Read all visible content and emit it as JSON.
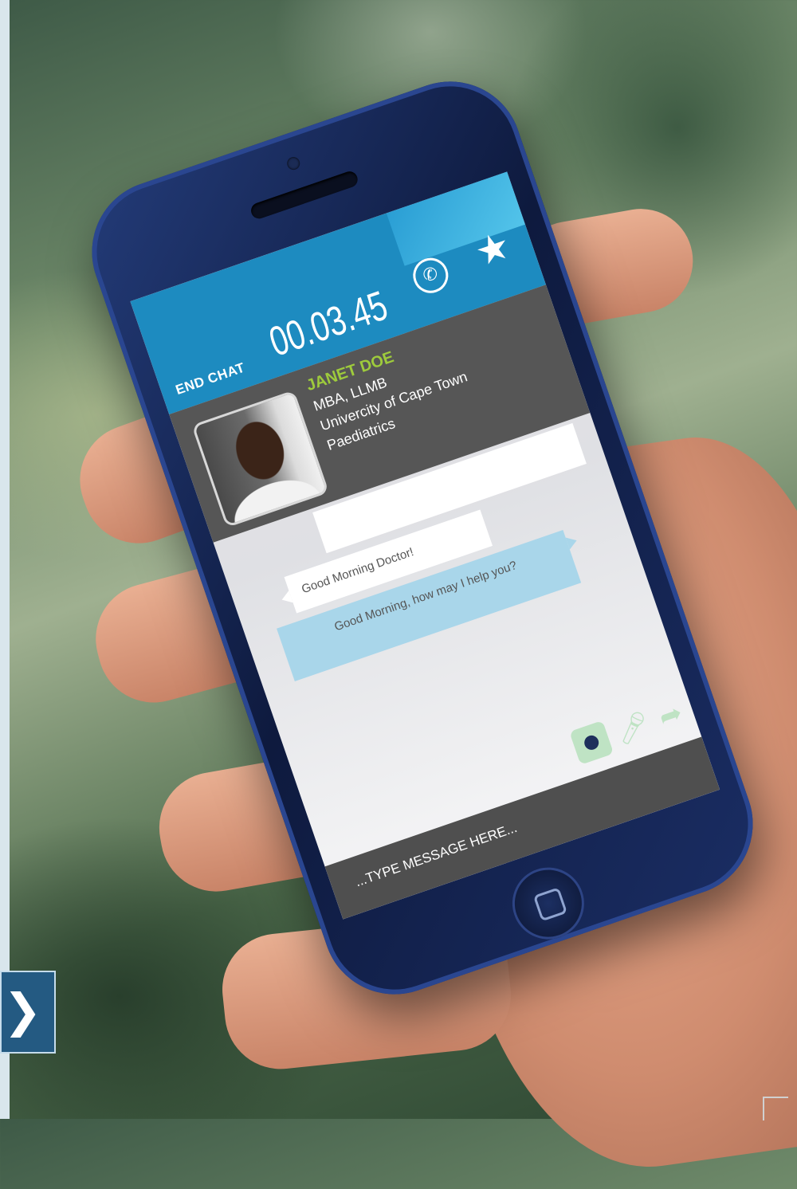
{
  "chat": {
    "end_chat_label": "END CHAT",
    "timer": "00.03.45",
    "call_icon": "phone-icon",
    "favorite_icon": "star-icon"
  },
  "doctor": {
    "name": "JANET DOE",
    "degrees": "MBA, LLMB",
    "institution": "Univercity of Cape Town",
    "specialty": "Paediatrics"
  },
  "messages": [
    {
      "from": "patient",
      "text": "Good Morning Doctor!"
    },
    {
      "from": "doctor",
      "text": "Good Morning, how may I help you?"
    }
  ],
  "composer": {
    "placeholder": "...TYPE MESSAGE HERE...",
    "camera_icon": "camera-icon",
    "mic_icon": "microphone-icon",
    "send_icon": "send-arrow-icon"
  },
  "nav": {
    "next_glyph": "❯"
  },
  "colors": {
    "header_blue": "#1d8bc0",
    "profile_gray": "#565656",
    "name_green": "#9ecb3c",
    "doctor_bubble": "#a9d6ea",
    "tool_green": "#bfe3c4"
  }
}
